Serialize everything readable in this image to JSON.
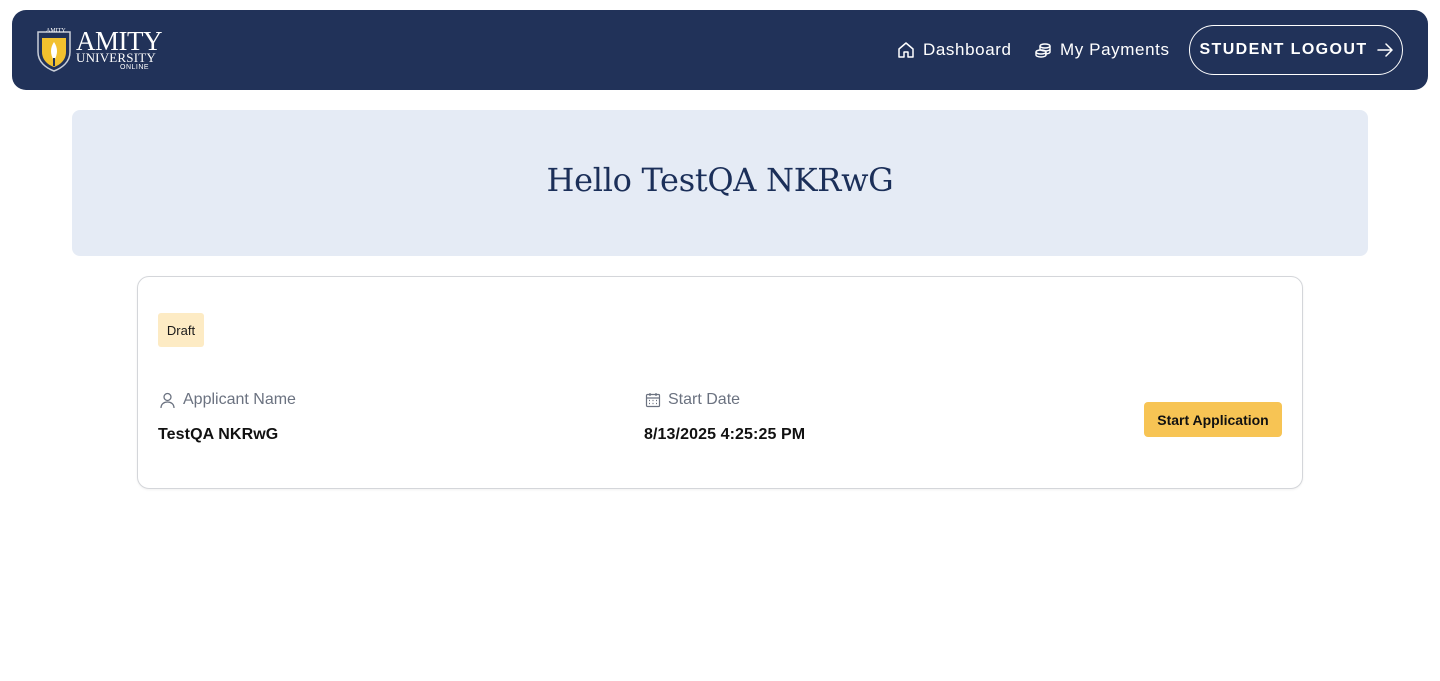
{
  "brand": {
    "logo_top": "AMITY",
    "logo_main": "AMITY",
    "logo_sub": "UNIVERSITY",
    "logo_online": "ONLINE"
  },
  "nav": {
    "dashboard": "Dashboard",
    "payments": "My Payments",
    "logout": "STUDENT LOGOUT"
  },
  "hero": {
    "greeting": "Hello TestQA NKRwG"
  },
  "application": {
    "status": "Draft",
    "applicant_label": "Applicant Name",
    "applicant_value": "TestQA NKRwG",
    "start_date_label": "Start Date",
    "start_date_value": "8/13/2025 4:25:25 PM",
    "action_label": "Start Application"
  },
  "colors": {
    "navbar": "#213259",
    "hero_bg": "#e5ebf5",
    "accent": "#f7c454",
    "badge_bg": "#fdebc4"
  }
}
